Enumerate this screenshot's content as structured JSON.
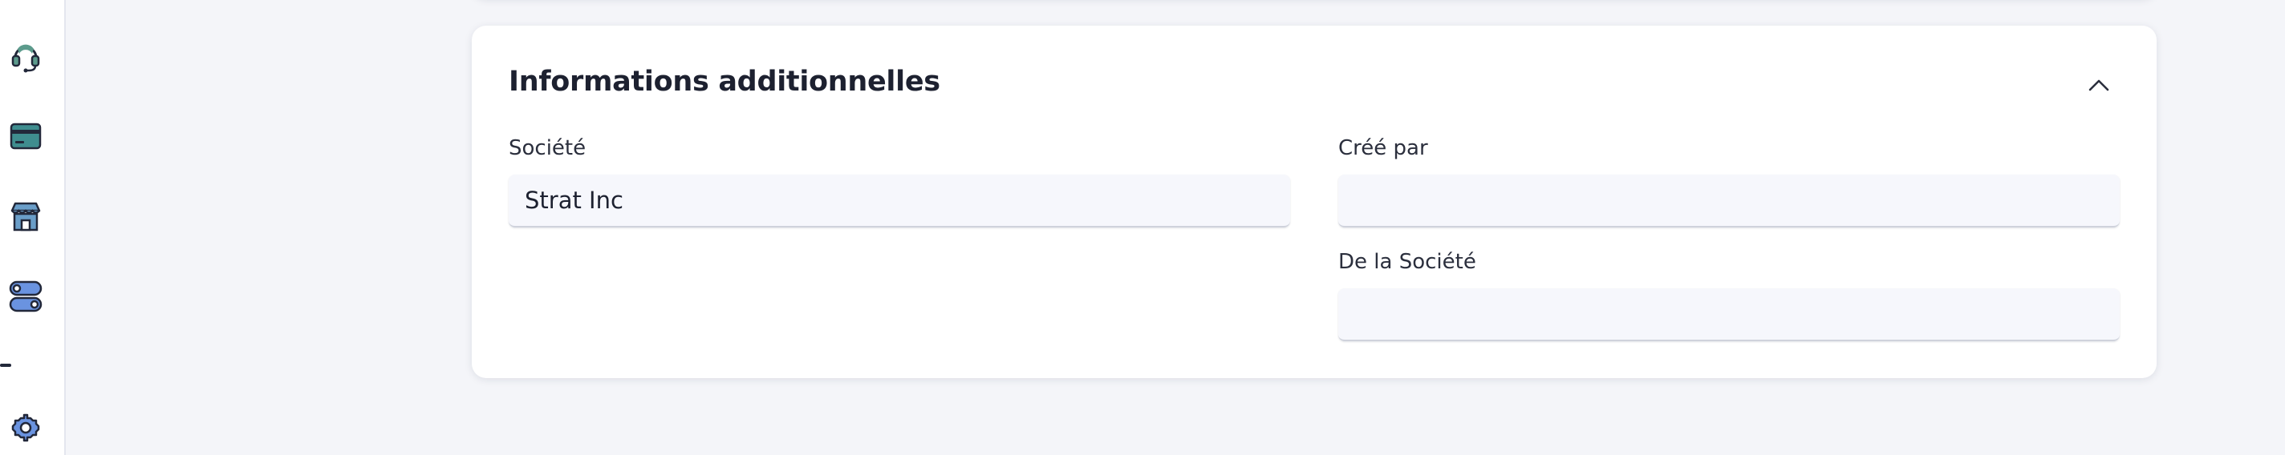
{
  "sidebar": {
    "icons": [
      "headset-icon",
      "credit-card-icon",
      "store-icon",
      "toggles-icon",
      "settings-gear-icon"
    ]
  },
  "colors": {
    "background": "#f4f5f9",
    "card": "#ffffff",
    "input_background": "#f6f7fc",
    "icon_green": "#5c9b8c",
    "icon_teal": "#3f8d8f",
    "icon_blue": "#6a93e0"
  },
  "section": {
    "title": "Informations additionnelles",
    "collapse_icon": "chevron-up-icon"
  },
  "fields": {
    "societe": {
      "label": "Société",
      "value": "Strat Inc"
    },
    "cree_par": {
      "label": "Créé par",
      "value": ""
    },
    "de_la_societe": {
      "label": "De la Société",
      "value": ""
    }
  }
}
